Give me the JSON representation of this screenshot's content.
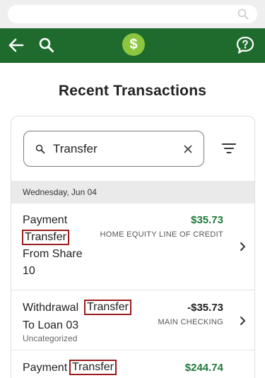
{
  "header": {
    "logo_symbol": "$"
  },
  "page": {
    "title": "Recent Transactions"
  },
  "search": {
    "query": "Transfer"
  },
  "date_group": {
    "label": "Wednesday, Jun 04"
  },
  "transactions": [
    {
      "line1": "Payment",
      "line2_highlight": "Transfer",
      "line3": "From Share",
      "line4": "10",
      "amount": "$35.73",
      "account": "HOME EQUITY LINE OF CREDIT"
    },
    {
      "line1_prefix": "Withdrawal",
      "line1_highlight": "Transfer",
      "line2": "To Loan 03",
      "category": "Uncategorized",
      "amount": "-$35.73",
      "account": "MAIN CHECKING"
    },
    {
      "line1_prefix": "Payment",
      "line1_highlight": "Transfer",
      "amount": "$244.74"
    }
  ],
  "colors": {
    "header_green": "#1f6b2e",
    "logo_green": "#8cc63f",
    "positive_amount": "#1f7a3a",
    "negative_amount": "#222222",
    "highlight_border": "#9b1c1c"
  },
  "icons": {
    "browser_search": "search-icon",
    "back": "arrow-left-icon",
    "app_search": "search-icon",
    "logo": "dollar-logo-icon",
    "help": "chat-help-icon",
    "filter": "filter-icon",
    "clear": "close-icon",
    "row_nav": "chevron-right-icon"
  }
}
